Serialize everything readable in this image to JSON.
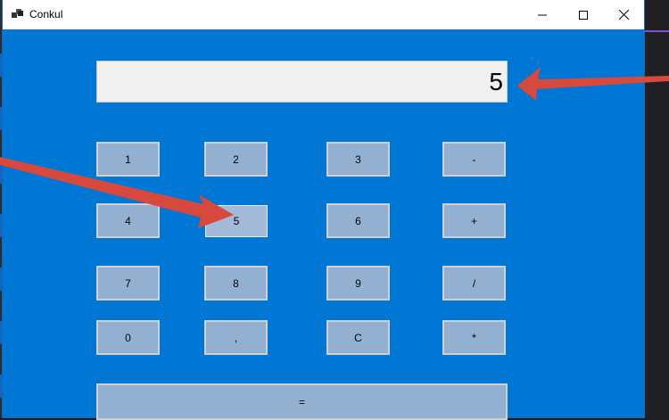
{
  "window": {
    "title": "Conkul"
  },
  "display": {
    "value": "5"
  },
  "keys": {
    "k1": "1",
    "k2": "2",
    "k3": "3",
    "minus": "-",
    "k4": "4",
    "k5": "5",
    "k6": "6",
    "plus": "+",
    "k7": "7",
    "k8": "8",
    "k9": "9",
    "divide": "/",
    "k0": "0",
    "comma": ",",
    "clear": "C",
    "multiply": "*",
    "equals": "="
  },
  "colors": {
    "window_bg": "#0077d5",
    "key_bg": "#94b0d0",
    "display_bg": "#f0f0f0",
    "annotation_arrow": "#d6493c"
  },
  "icons": [
    "app-icon",
    "minimize-icon",
    "maximize-icon",
    "close-icon",
    "annotation-arrow"
  ]
}
